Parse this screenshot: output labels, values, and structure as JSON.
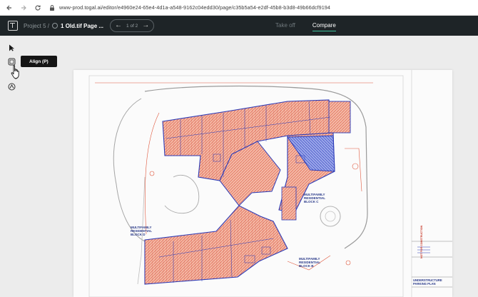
{
  "browser": {
    "url": "www-prod.togal.ai/editor/e4960e24-65e4-4d1a-a548-9162c04edd30/page/c35b5a54-e2df-45b8-b3d8-49b66dcf9194"
  },
  "header": {
    "project_label": "Project 5 /",
    "document_title": "1 Old.tif Page ...",
    "page_indicator": "1 of 2",
    "tabs": [
      {
        "label": "Take off",
        "active": false
      },
      {
        "label": "Compare",
        "active": true
      }
    ],
    "accent_color": "#3fbf9b",
    "bar_color": "#1e2427"
  },
  "tools": {
    "align_tooltip": "Align (P)",
    "items": [
      "pointer-icon",
      "align-icon",
      "overlay-icon"
    ]
  },
  "drawing": {
    "labels": {
      "block_c": "MULTIFAMILY RESIDENTIAL BLOCK C",
      "block_b": "MULTIFAMILY RESIDENTIAL BLOCK B",
      "block_d": "MULTIFAMILY RESIDENTIAL BLOCK D",
      "sheet_title": "UNDERSTRUCTURE PARKING PLAN",
      "stamp": "NOT FOR CONSTRUCTION"
    },
    "overlay_colors": {
      "old": "#e0573c",
      "new": "#2b3bb8"
    }
  }
}
